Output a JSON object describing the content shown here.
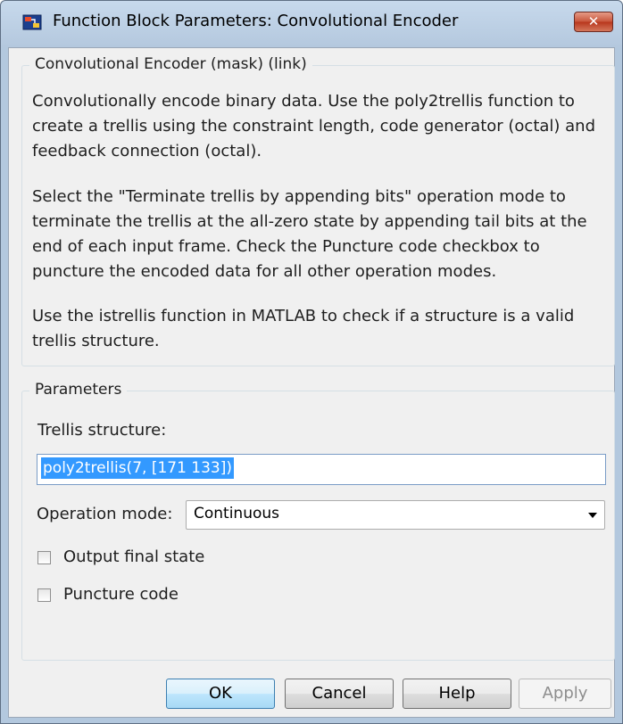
{
  "window": {
    "title": "Function Block Parameters: Convolutional Encoder",
    "close_label": "✕"
  },
  "mask_group": {
    "label": "Convolutional Encoder (mask) (link)",
    "paragraphs": [
      "Convolutionally encode binary data.  Use the poly2trellis function to create a trellis using the constraint length, code generator (octal) and feedback connection (octal).",
      "Select the \"Terminate trellis by appending bits\" operation mode to terminate the trellis at the all-zero state by appending tail bits at the end of each input frame.  Check the Puncture code checkbox to puncture the encoded data for all other operation modes.",
      "Use the istrellis function in MATLAB to check if a structure is a valid trellis structure."
    ]
  },
  "parameters": {
    "label": "Parameters",
    "trellis_label": "Trellis structure:",
    "trellis_value": "poly2trellis(7, [171 133])",
    "operation_mode_label": "Operation mode:",
    "operation_mode_value": "Continuous",
    "output_final_state_label": "Output final state",
    "output_final_state_checked": false,
    "puncture_code_label": "Puncture code",
    "puncture_code_checked": false
  },
  "buttons": {
    "ok": "OK",
    "cancel": "Cancel",
    "help": "Help",
    "apply": "Apply"
  },
  "icons": {
    "app_icon": "simulink-block-icon",
    "close_icon": "close-icon",
    "dropdown_icon": "chevron-down-icon"
  }
}
